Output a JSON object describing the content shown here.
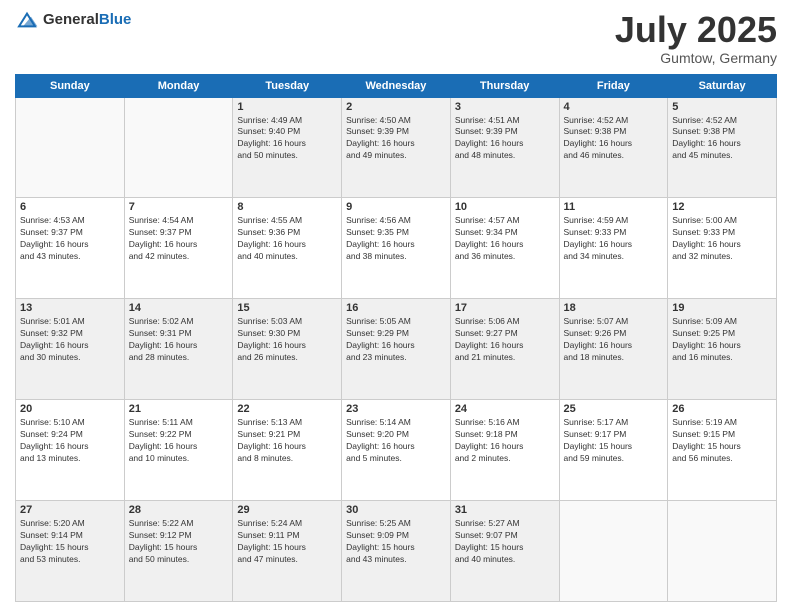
{
  "logo": {
    "general": "General",
    "blue": "Blue"
  },
  "title": {
    "month_year": "July 2025",
    "location": "Gumtow, Germany"
  },
  "weekdays": [
    "Sunday",
    "Monday",
    "Tuesday",
    "Wednesday",
    "Thursday",
    "Friday",
    "Saturday"
  ],
  "weeks": [
    [
      {
        "day": "",
        "info": ""
      },
      {
        "day": "",
        "info": ""
      },
      {
        "day": "1",
        "info": "Sunrise: 4:49 AM\nSunset: 9:40 PM\nDaylight: 16 hours\nand 50 minutes."
      },
      {
        "day": "2",
        "info": "Sunrise: 4:50 AM\nSunset: 9:39 PM\nDaylight: 16 hours\nand 49 minutes."
      },
      {
        "day": "3",
        "info": "Sunrise: 4:51 AM\nSunset: 9:39 PM\nDaylight: 16 hours\nand 48 minutes."
      },
      {
        "day": "4",
        "info": "Sunrise: 4:52 AM\nSunset: 9:38 PM\nDaylight: 16 hours\nand 46 minutes."
      },
      {
        "day": "5",
        "info": "Sunrise: 4:52 AM\nSunset: 9:38 PM\nDaylight: 16 hours\nand 45 minutes."
      }
    ],
    [
      {
        "day": "6",
        "info": "Sunrise: 4:53 AM\nSunset: 9:37 PM\nDaylight: 16 hours\nand 43 minutes."
      },
      {
        "day": "7",
        "info": "Sunrise: 4:54 AM\nSunset: 9:37 PM\nDaylight: 16 hours\nand 42 minutes."
      },
      {
        "day": "8",
        "info": "Sunrise: 4:55 AM\nSunset: 9:36 PM\nDaylight: 16 hours\nand 40 minutes."
      },
      {
        "day": "9",
        "info": "Sunrise: 4:56 AM\nSunset: 9:35 PM\nDaylight: 16 hours\nand 38 minutes."
      },
      {
        "day": "10",
        "info": "Sunrise: 4:57 AM\nSunset: 9:34 PM\nDaylight: 16 hours\nand 36 minutes."
      },
      {
        "day": "11",
        "info": "Sunrise: 4:59 AM\nSunset: 9:33 PM\nDaylight: 16 hours\nand 34 minutes."
      },
      {
        "day": "12",
        "info": "Sunrise: 5:00 AM\nSunset: 9:33 PM\nDaylight: 16 hours\nand 32 minutes."
      }
    ],
    [
      {
        "day": "13",
        "info": "Sunrise: 5:01 AM\nSunset: 9:32 PM\nDaylight: 16 hours\nand 30 minutes."
      },
      {
        "day": "14",
        "info": "Sunrise: 5:02 AM\nSunset: 9:31 PM\nDaylight: 16 hours\nand 28 minutes."
      },
      {
        "day": "15",
        "info": "Sunrise: 5:03 AM\nSunset: 9:30 PM\nDaylight: 16 hours\nand 26 minutes."
      },
      {
        "day": "16",
        "info": "Sunrise: 5:05 AM\nSunset: 9:29 PM\nDaylight: 16 hours\nand 23 minutes."
      },
      {
        "day": "17",
        "info": "Sunrise: 5:06 AM\nSunset: 9:27 PM\nDaylight: 16 hours\nand 21 minutes."
      },
      {
        "day": "18",
        "info": "Sunrise: 5:07 AM\nSunset: 9:26 PM\nDaylight: 16 hours\nand 18 minutes."
      },
      {
        "day": "19",
        "info": "Sunrise: 5:09 AM\nSunset: 9:25 PM\nDaylight: 16 hours\nand 16 minutes."
      }
    ],
    [
      {
        "day": "20",
        "info": "Sunrise: 5:10 AM\nSunset: 9:24 PM\nDaylight: 16 hours\nand 13 minutes."
      },
      {
        "day": "21",
        "info": "Sunrise: 5:11 AM\nSunset: 9:22 PM\nDaylight: 16 hours\nand 10 minutes."
      },
      {
        "day": "22",
        "info": "Sunrise: 5:13 AM\nSunset: 9:21 PM\nDaylight: 16 hours\nand 8 minutes."
      },
      {
        "day": "23",
        "info": "Sunrise: 5:14 AM\nSunset: 9:20 PM\nDaylight: 16 hours\nand 5 minutes."
      },
      {
        "day": "24",
        "info": "Sunrise: 5:16 AM\nSunset: 9:18 PM\nDaylight: 16 hours\nand 2 minutes."
      },
      {
        "day": "25",
        "info": "Sunrise: 5:17 AM\nSunset: 9:17 PM\nDaylight: 15 hours\nand 59 minutes."
      },
      {
        "day": "26",
        "info": "Sunrise: 5:19 AM\nSunset: 9:15 PM\nDaylight: 15 hours\nand 56 minutes."
      }
    ],
    [
      {
        "day": "27",
        "info": "Sunrise: 5:20 AM\nSunset: 9:14 PM\nDaylight: 15 hours\nand 53 minutes."
      },
      {
        "day": "28",
        "info": "Sunrise: 5:22 AM\nSunset: 9:12 PM\nDaylight: 15 hours\nand 50 minutes."
      },
      {
        "day": "29",
        "info": "Sunrise: 5:24 AM\nSunset: 9:11 PM\nDaylight: 15 hours\nand 47 minutes."
      },
      {
        "day": "30",
        "info": "Sunrise: 5:25 AM\nSunset: 9:09 PM\nDaylight: 15 hours\nand 43 minutes."
      },
      {
        "day": "31",
        "info": "Sunrise: 5:27 AM\nSunset: 9:07 PM\nDaylight: 15 hours\nand 40 minutes."
      },
      {
        "day": "",
        "info": ""
      },
      {
        "day": "",
        "info": ""
      }
    ]
  ]
}
